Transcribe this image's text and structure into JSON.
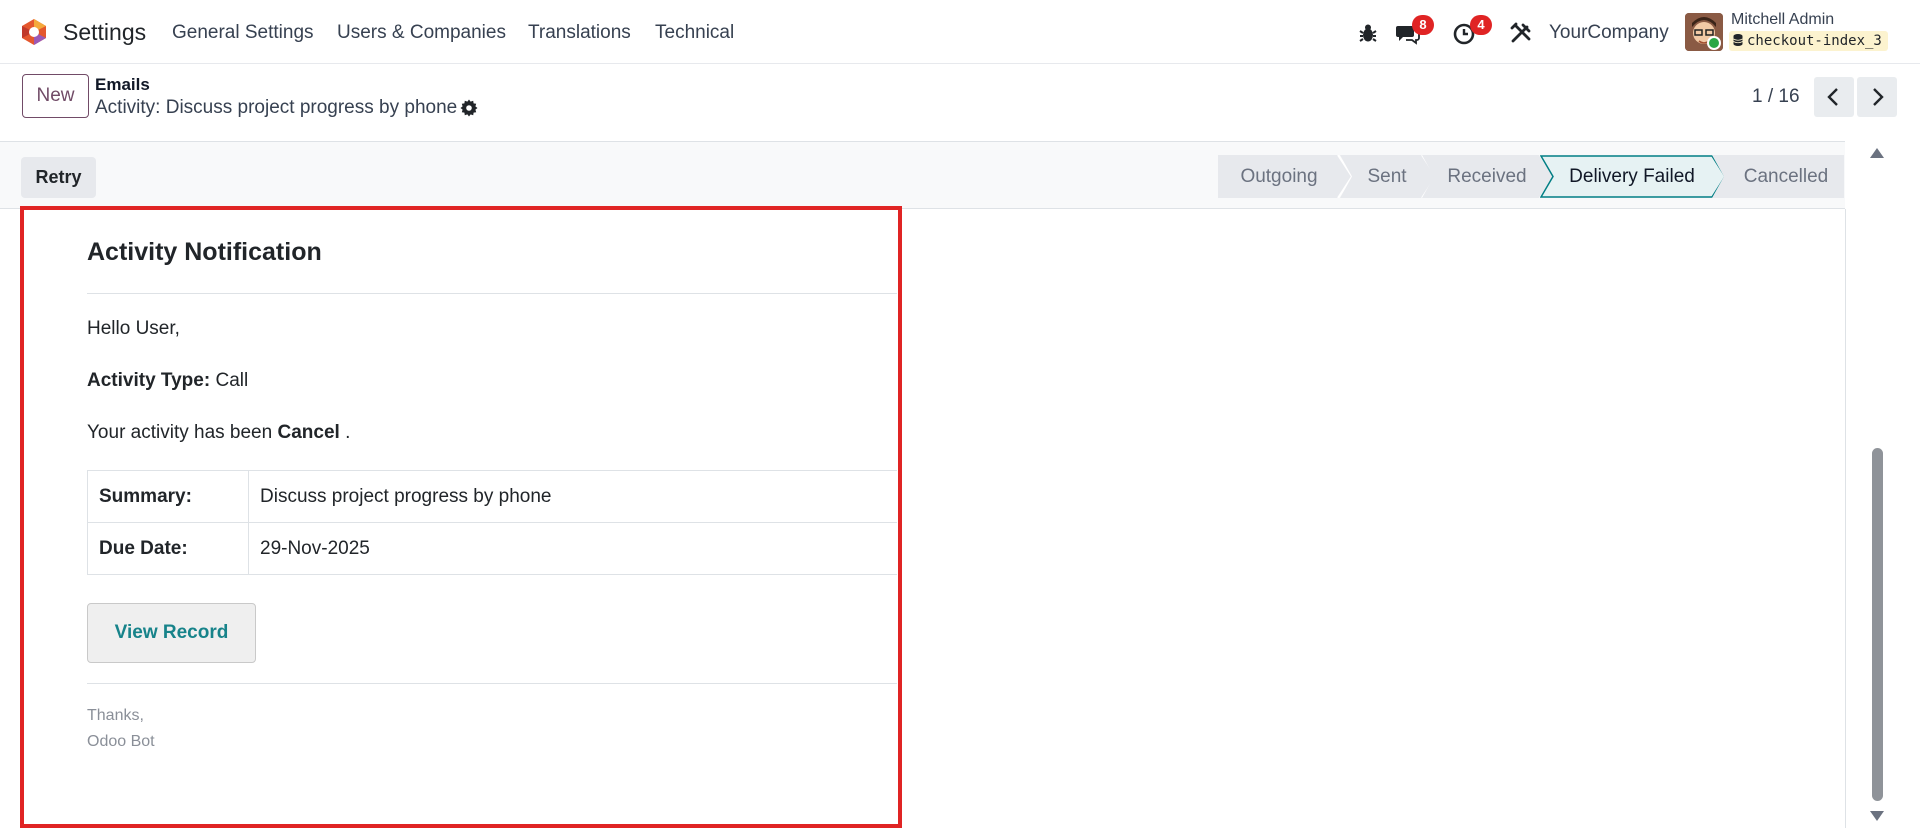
{
  "navbar": {
    "app_name": "Settings",
    "menu": [
      "General Settings",
      "Users & Companies",
      "Translations",
      "Technical"
    ],
    "messages_count": "8",
    "activities_count": "4",
    "company": "YourCompany",
    "user_name": "Mitchell Admin",
    "database": "checkout-index_3",
    "colors": {
      "brand": "#714b67",
      "badge": "#e02424"
    },
    "icons": [
      "odoo-logo-icon",
      "bug-icon",
      "chat-icon",
      "clock-icon",
      "tools-icon",
      "database-icon"
    ]
  },
  "control_panel": {
    "new_label": "New",
    "breadcrumb_parent": "Emails",
    "record_title": "Activity: Discuss project progress by phone",
    "pager_value": "1 / 16"
  },
  "statusbar": {
    "retry_label": "Retry",
    "stages": [
      "Outgoing",
      "Sent",
      "Received",
      "Delivery Failed",
      "Cancelled"
    ],
    "active_stage": "Delivery Failed",
    "active_color": "#017e84"
  },
  "email": {
    "title": "Activity Notification",
    "greeting": "Hello User,",
    "activity_type_label": "Activity Type:",
    "activity_type_value": "Call",
    "status_prefix": "Your activity has been",
    "status_value": "Cancel",
    "status_suffix": ".",
    "table": [
      {
        "label": "Summary:",
        "value": "Discuss project progress by phone"
      },
      {
        "label": "Due Date:",
        "value": "29-Nov-2025"
      }
    ],
    "button_label": "View Record",
    "thanks": "Thanks,",
    "signature": "Odoo Bot",
    "highlight_color": "#e02424"
  }
}
